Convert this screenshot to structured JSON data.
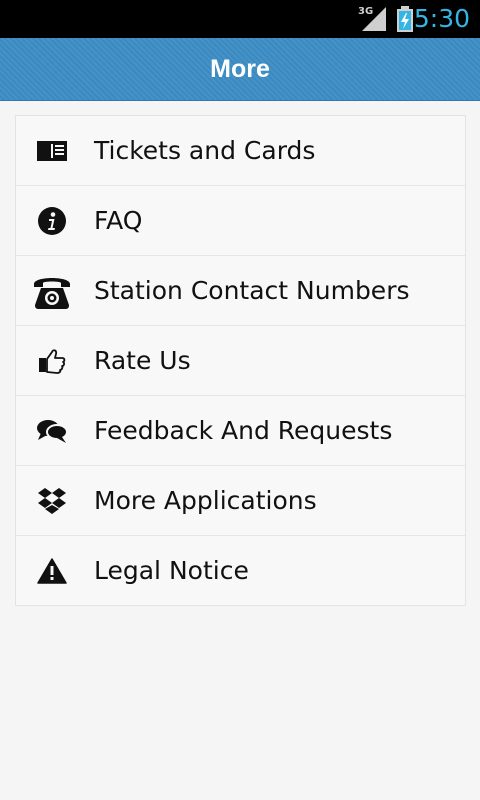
{
  "status_bar": {
    "network": "3G",
    "time": "5:30",
    "signal_icon": "signal-icon",
    "battery_icon": "battery-charging-icon"
  },
  "header": {
    "title": "More"
  },
  "menu": {
    "items": [
      {
        "label": "Tickets and Cards",
        "icon": "ticket-icon"
      },
      {
        "label": "FAQ",
        "icon": "info-icon"
      },
      {
        "label": "Station Contact Numbers",
        "icon": "phone-icon"
      },
      {
        "label": "Rate Us",
        "icon": "thumbs-up-icon"
      },
      {
        "label": "Feedback And Requests",
        "icon": "chat-bubbles-icon"
      },
      {
        "label": "More Applications",
        "icon": "dropbox-icon"
      },
      {
        "label": "Legal Notice",
        "icon": "warning-icon"
      }
    ]
  },
  "colors": {
    "header_bg": "#3d8ec5",
    "status_accent": "#33b5e5",
    "background": "#f5f5f5"
  }
}
